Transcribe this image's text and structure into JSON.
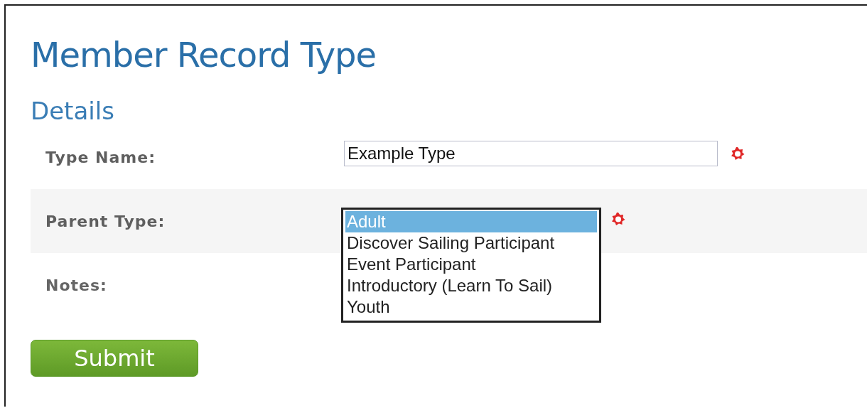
{
  "page": {
    "title": "Member Record Type",
    "section": "Details"
  },
  "fields": [
    {
      "kind": "text",
      "label": "Type Name:",
      "value": "Example Type",
      "required": true
    },
    {
      "kind": "listbox",
      "label": "Parent Type:",
      "required": true,
      "options": [
        {
          "label": "Adult",
          "selected": true
        },
        {
          "label": "Discover Sailing Participant",
          "selected": false
        },
        {
          "label": "Event Participant",
          "selected": false
        },
        {
          "label": "Introductory (Learn To Sail)",
          "selected": false
        },
        {
          "label": "Youth",
          "selected": false
        }
      ]
    },
    {
      "kind": "notes",
      "label": "Notes:"
    }
  ],
  "buttons": [
    {
      "label": "Submit"
    }
  ]
}
